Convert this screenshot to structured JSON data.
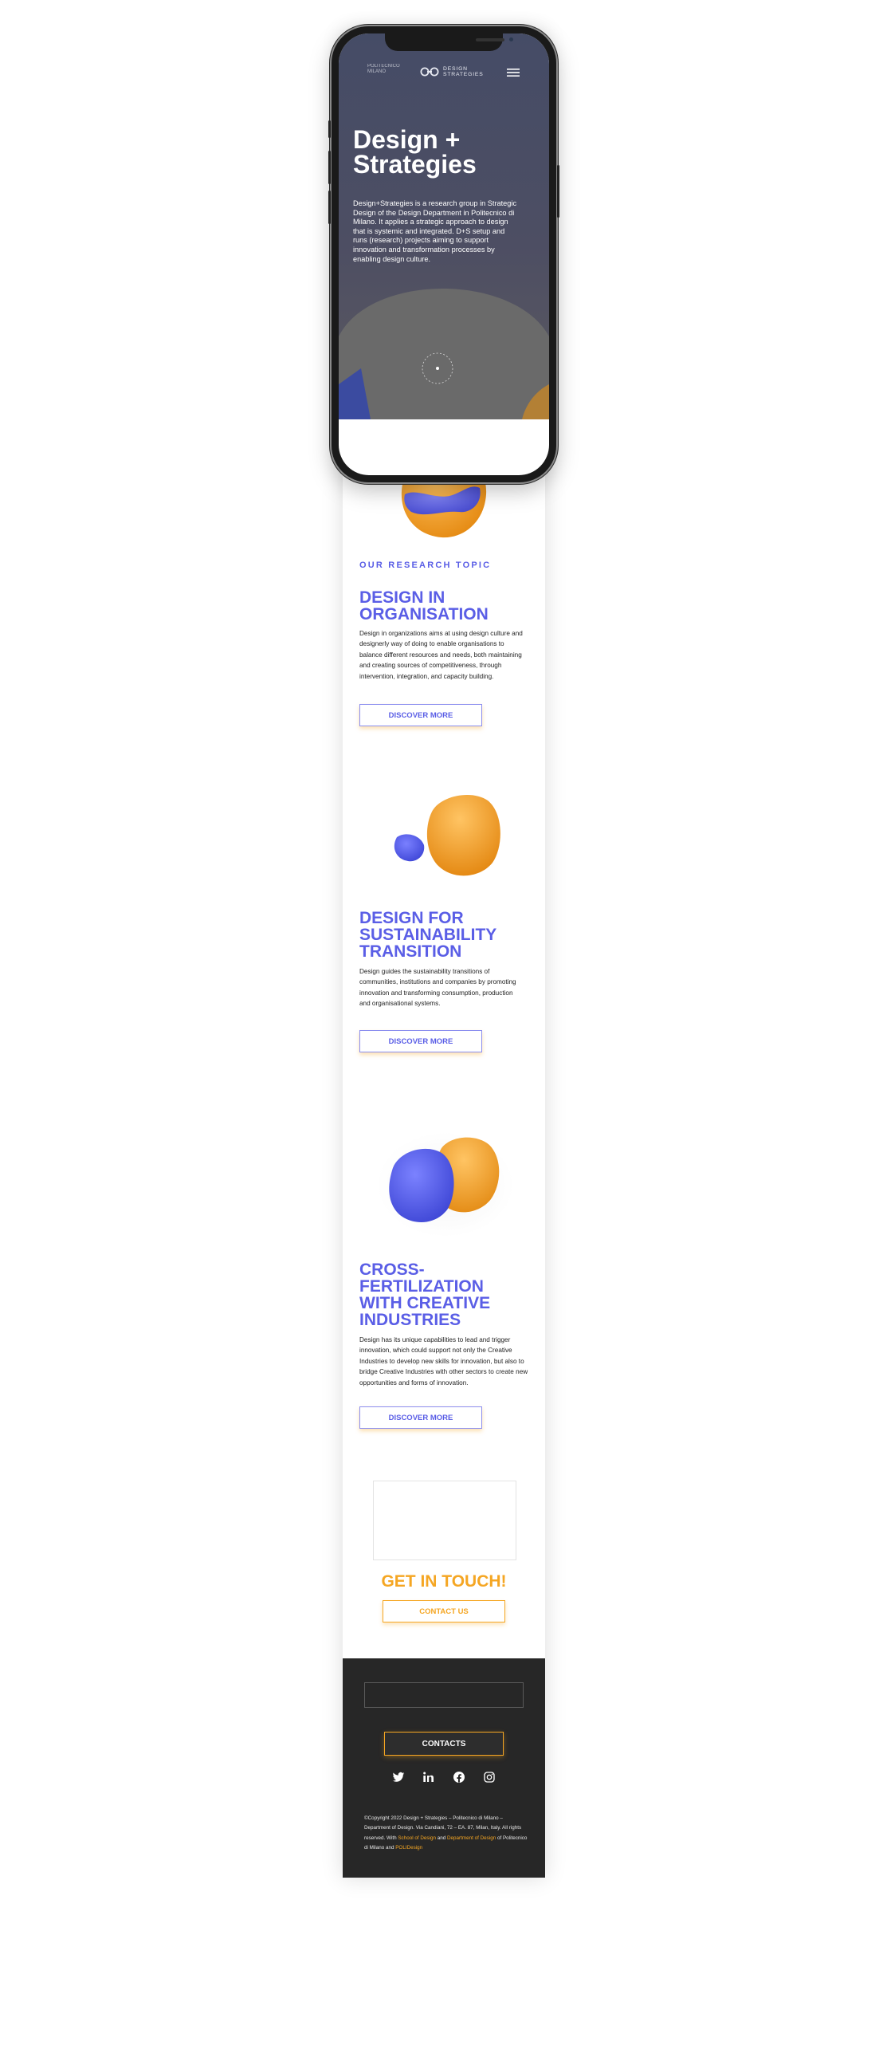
{
  "hero": {
    "title": "Design + Strategies",
    "text": "Design+Strategies is a research group in Strategic Design of the Design Department in Politecnico di Milano. It applies a strategic approach to design that is systemic and integrated. D+S setup and runs (research) projects aiming to support innovation and transformation processes by enabling design culture."
  },
  "nav": {
    "logo_primary": "POLITECNICO MILANO",
    "logo_secondary_line1": "DESIGN",
    "logo_secondary_line2": "STRATEGIES",
    "menu_icon": "hamburger-icon"
  },
  "research": {
    "kicker": "OUR RESEARCH TOPIC",
    "topics": [
      {
        "title": "DESIGN IN ORGANISATION",
        "text": "Design in organizations aims at using design culture and designerly way of doing to enable organisations to balance different resources and needs, both maintaining and creating sources of competitiveness, through intervention, integration, and capacity building.",
        "button": "DISCOVER MORE"
      },
      {
        "title": "DESIGN FOR SUSTAINABILITY TRANSITION",
        "text": "Design guides the sustainability transitions of communities, institutions and companies by promoting innovation and transforming consumption, production and organisational systems.",
        "button": "DISCOVER MORE"
      },
      {
        "title": "CROSS-FERTILIZATION WITH CREATIVE INDUSTRIES",
        "text": "Design has its unique capabilities to lead and trigger innovation, which could support not only the Creative Industries to develop new skills for innovation, but also to bridge Creative Industries with other sectors to create new opportunities and forms of innovation.",
        "button": "DISCOVER MORE"
      }
    ]
  },
  "cta": {
    "title": "GET IN TOUCH!",
    "button": "CONTACT US"
  },
  "footer": {
    "contacts_button": "CONTACTS",
    "social_icons": [
      "twitter-icon",
      "linkedin-icon",
      "facebook-icon",
      "instagram-icon"
    ],
    "copyright_part1": "©Copyright 2022 Design + Strategies – Politecnico di Milano – Department of Design. Via Candiani, 72 – EA. 87, Milan, Italy. All rights reserved. With ",
    "link1": "School of Design",
    "copyright_part2": " and ",
    "link2": "Department of Design",
    "copyright_part3": " of Politecnico di Milano and ",
    "link3": "POLIDesign"
  },
  "colors": {
    "accent_blue": "#5a5ee6",
    "accent_orange": "#f5a623",
    "footer_bg": "#272727"
  }
}
